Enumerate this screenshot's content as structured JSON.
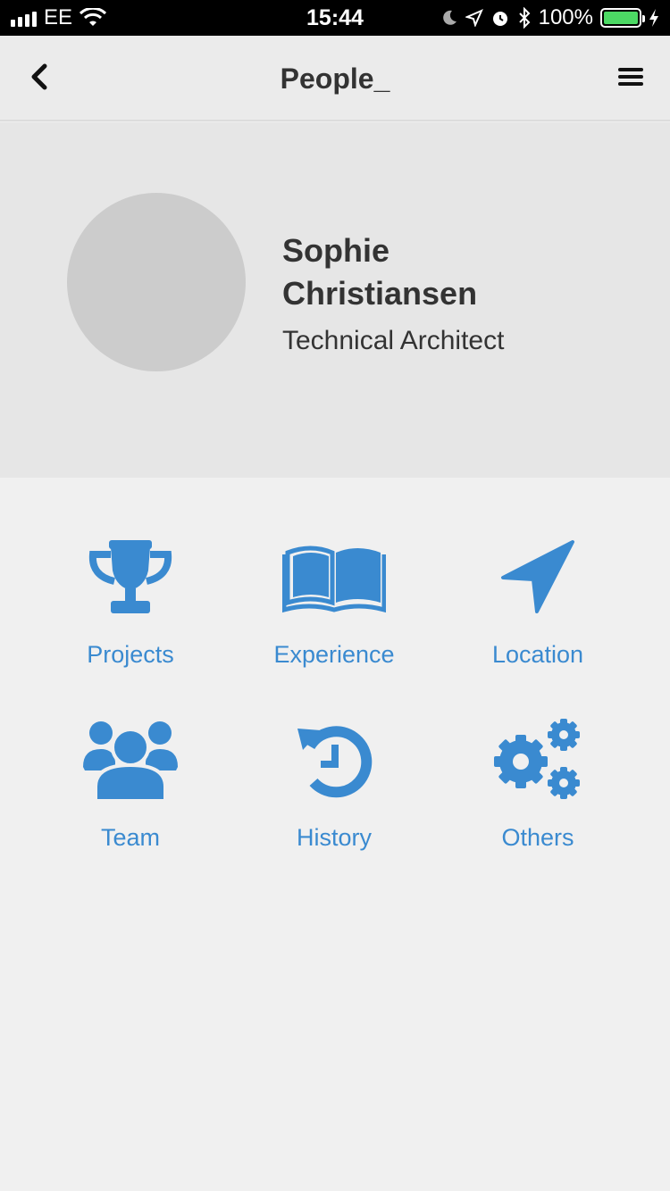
{
  "status_bar": {
    "carrier": "EE",
    "time": "15:44",
    "battery": "100%"
  },
  "nav": {
    "title": "People_"
  },
  "profile": {
    "first_name": "Sophie",
    "last_name": "Christiansen",
    "role": "Technical Architect"
  },
  "tiles": [
    {
      "label": "Projects",
      "icon": "trophy-icon"
    },
    {
      "label": "Experience",
      "icon": "open-book-icon"
    },
    {
      "label": "Location",
      "icon": "location-arrow-icon"
    },
    {
      "label": "Team",
      "icon": "team-icon"
    },
    {
      "label": "History",
      "icon": "history-icon"
    },
    {
      "label": "Others",
      "icon": "gears-icon"
    }
  ],
  "colors": {
    "accent": "#3a8ad0",
    "battery_fill": "#4cd964"
  }
}
